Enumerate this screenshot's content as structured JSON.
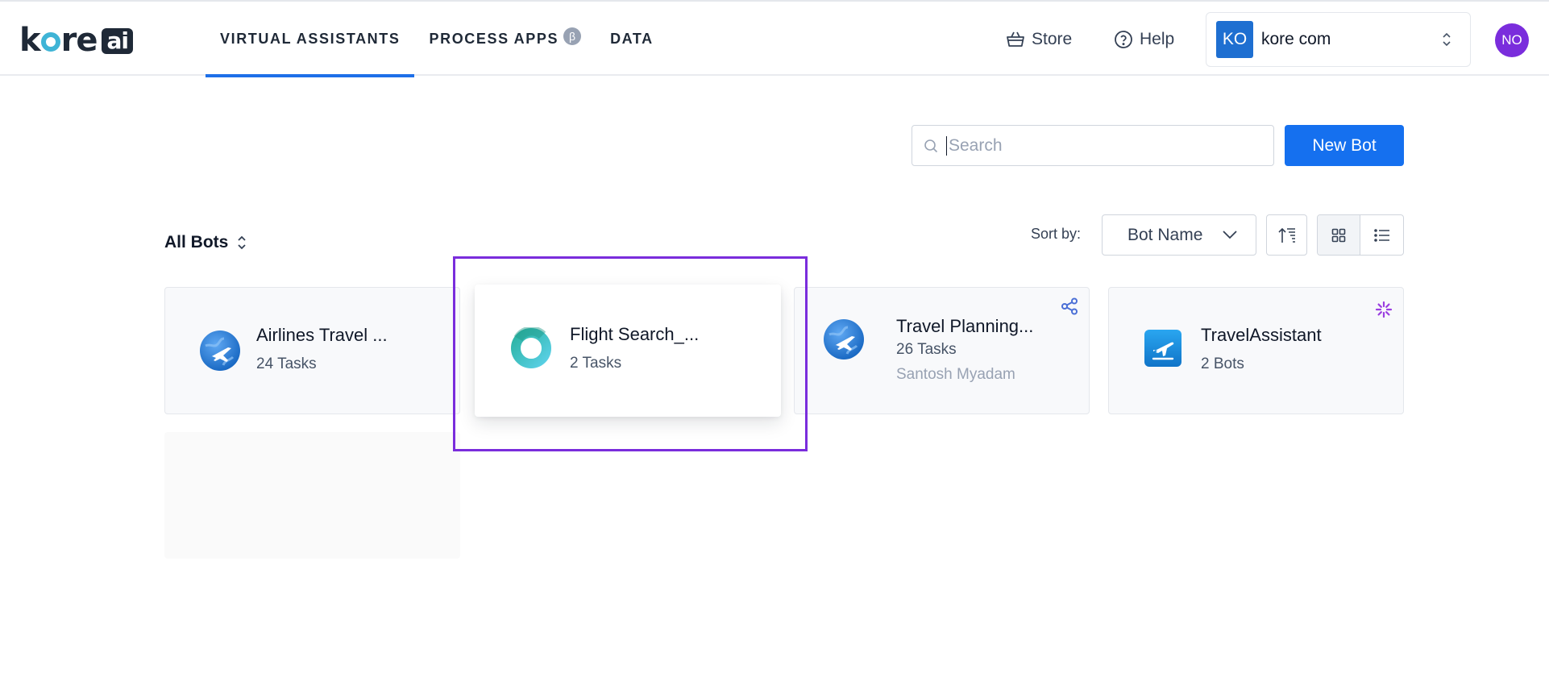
{
  "header": {
    "logo": {
      "text_pre": "k",
      "text_post": "re",
      "text_ai": "ai"
    },
    "nav": [
      {
        "label": "VIRTUAL ASSISTANTS",
        "active": true
      },
      {
        "label": "PROCESS APPS",
        "badge": "β"
      },
      {
        "label": "DATA"
      }
    ],
    "store_label": "Store",
    "help_label": "Help",
    "account": {
      "initials": "KO",
      "name": "kore com"
    },
    "avatar_initials": "NO"
  },
  "toolbar": {
    "search_placeholder": "Search",
    "new_bot_label": "New Bot",
    "filter_label": "All Bots",
    "sort_label": "Sort by:",
    "sort_value": "Bot Name",
    "view_mode": "grid"
  },
  "bots": [
    {
      "title": "Airlines Travel ...",
      "subtitle": "24 Tasks",
      "icon": "globe-plane-icon"
    },
    {
      "title": "Flight Search_...",
      "subtitle": "2 Tasks",
      "icon": "ring-icon"
    },
    {
      "title": "Travel Planning...",
      "subtitle": "26 Tasks",
      "owner": "Santosh Myadam",
      "icon": "globe-plane-icon",
      "badge": "share-icon"
    },
    {
      "title": "TravelAssistant",
      "subtitle": "2 Bots",
      "icon": "airplane-takeoff-icon",
      "badge": "sparkle-icon"
    }
  ],
  "colors": {
    "accent": "#1570ef",
    "highlight": "#7a2ddc",
    "avatar": "#7a2ddc",
    "account_badge": "#1e6fd1"
  }
}
